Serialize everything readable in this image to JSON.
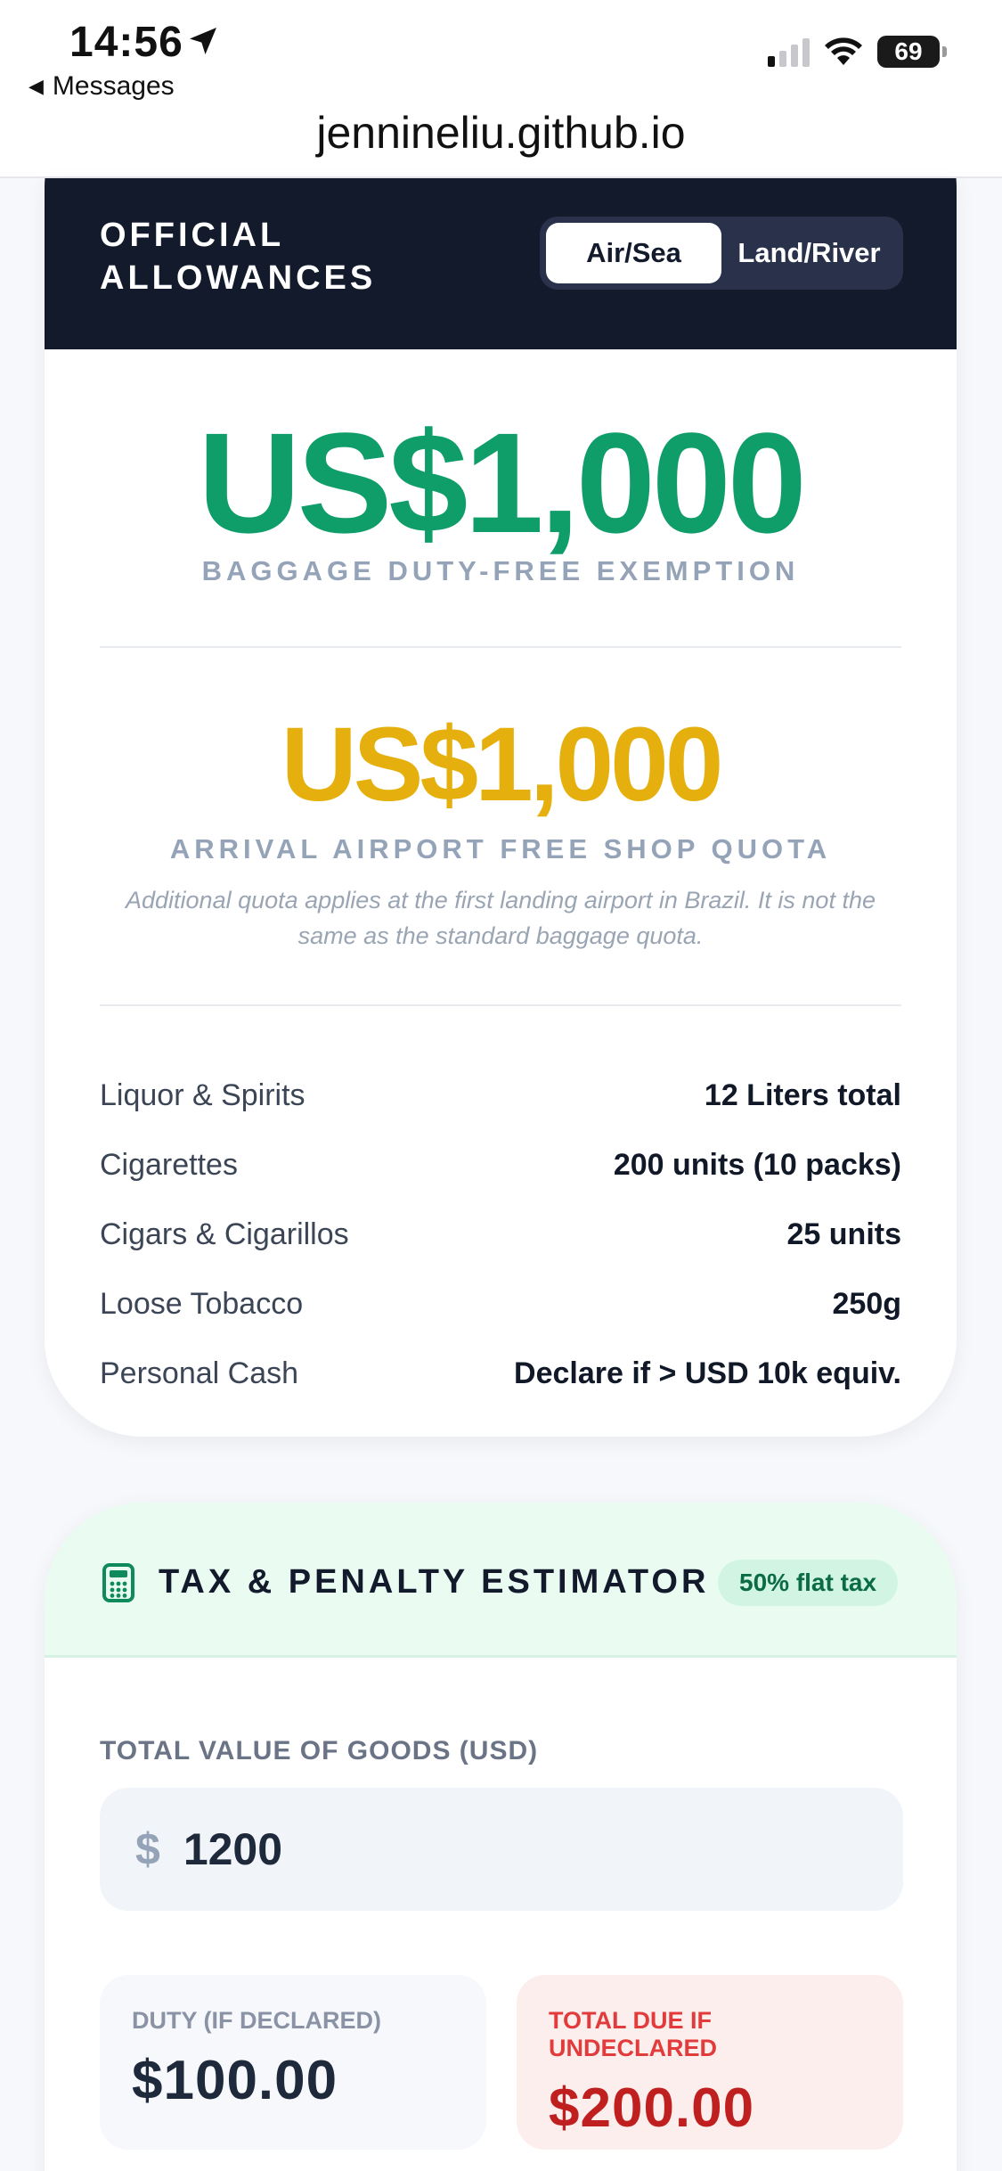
{
  "status_bar": {
    "time": "14:56",
    "back_label": "Messages",
    "battery": "69"
  },
  "browser": {
    "url": "jennineliu.github.io"
  },
  "allowances": {
    "title_line1": "OFFICIAL",
    "title_line2": "ALLOWANCES",
    "toggle": {
      "options": [
        "Air/Sea",
        "Land/River"
      ],
      "selected": "Air/Sea"
    },
    "baggage": {
      "amount": "US$1,000",
      "label": "BAGGAGE DUTY-FREE EXEMPTION"
    },
    "free_shop": {
      "amount": "US$1,000",
      "label": "ARRIVAL AIRPORT FREE SHOP QUOTA",
      "note": "Additional quota applies at the first landing airport in Brazil. It is not the same as the standard baggage quota."
    },
    "rows": [
      {
        "label": "Liquor & Spirits",
        "value": "12 Liters total"
      },
      {
        "label": "Cigarettes",
        "value": "200 units (10 packs)"
      },
      {
        "label": "Cigars & Cigarillos",
        "value": "25 units"
      },
      {
        "label": "Loose Tobacco",
        "value": "250g"
      },
      {
        "label": "Personal Cash",
        "value": "Declare if > USD 10k equiv."
      }
    ]
  },
  "estimator": {
    "title": "TAX & PENALTY ESTIMATOR",
    "badge": "50% flat tax",
    "field_label": "TOTAL VALUE OF GOODS (USD)",
    "currency_symbol": "$",
    "field_value": "1200",
    "duty": {
      "label": "DUTY (IF DECLARED)",
      "value": "$100.00"
    },
    "total": {
      "label": "TOTAL DUE IF UNDECLARED",
      "value": "$200.00"
    }
  },
  "colors": {
    "header_navy": "#121a2c",
    "green_accent": "#0f9d6a",
    "yellow_accent": "#e5b00e",
    "red_accent": "#c01f1f"
  }
}
